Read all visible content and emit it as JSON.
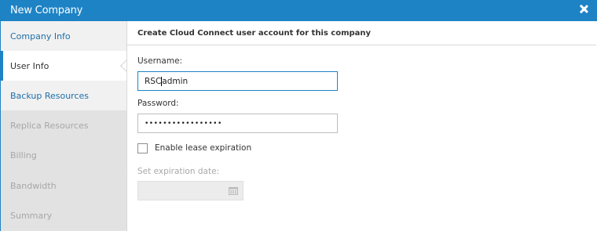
{
  "window": {
    "title": "New Company"
  },
  "sidebar": {
    "items": [
      {
        "label": "Company Info",
        "state": "enabled"
      },
      {
        "label": "User Info",
        "state": "active"
      },
      {
        "label": "Backup Resources",
        "state": "enabled"
      },
      {
        "label": "Replica Resources",
        "state": "disabled"
      },
      {
        "label": "Billing",
        "state": "disabled"
      },
      {
        "label": "Bandwidth",
        "state": "disabled"
      },
      {
        "label": "Summary",
        "state": "disabled"
      }
    ]
  },
  "main": {
    "header": "Create Cloud Connect user account for this company",
    "username": {
      "label": "Username:",
      "value_before_caret": "RSC",
      "value_after_caret": "admin"
    },
    "password": {
      "label": "Password:",
      "masked_value": "•••••••••••••••••"
    },
    "lease_expiration": {
      "label": "Enable lease expiration",
      "checked": false
    },
    "expiration_date": {
      "label": "Set expiration date:",
      "value": "",
      "disabled": true
    }
  },
  "colors": {
    "accent": "#1e83c5",
    "link": "#1e6fa8",
    "disabled_text": "#a7a7a7"
  },
  "icons": {
    "close": "close-icon",
    "calendar": "calendar-icon"
  }
}
